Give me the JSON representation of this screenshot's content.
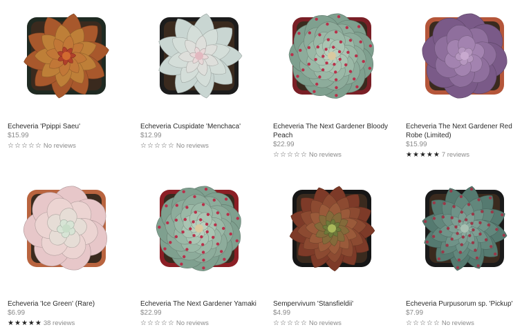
{
  "products": [
    {
      "title": "Echeveria 'Ppippi Saeu'",
      "price": "$15.99",
      "reviews": "No reviews",
      "stars_filled": 0,
      "plant": "rust-star",
      "pot_color": "#1f2a22"
    },
    {
      "title": "Echeveria Cuspidate 'Menchaca'",
      "price": "$12.99",
      "reviews": "No reviews",
      "stars_filled": 0,
      "plant": "pale-spiky",
      "pot_color": "#1c1c1c"
    },
    {
      "title": "Echeveria The Next Gardener Bloody Peach",
      "price": "$22.99",
      "reviews": "No reviews",
      "stars_filled": 0,
      "plant": "green-red-tipped",
      "pot_color": "#7a1f26"
    },
    {
      "title": "Echeveria The Next Gardener Red Robe (Limited)",
      "price": "$15.99",
      "reviews": "7 reviews",
      "stars_filled": 5,
      "plant": "purple-rose",
      "pot_color": "#b5563a"
    },
    {
      "title": "Echeveria 'Ice Green' (Rare)",
      "price": "$6.99",
      "reviews": "38 reviews",
      "stars_filled": 5,
      "plant": "pink-white",
      "pot_color": "#b9643f"
    },
    {
      "title": "Echeveria The Next Gardener Yamaki",
      "price": "$22.99",
      "reviews": "No reviews",
      "stars_filled": 0,
      "plant": "green-red-tipped",
      "pot_color": "#8c1f25"
    },
    {
      "title": "Sempervivum 'Stansfieldii'",
      "price": "$4.99",
      "reviews": "No reviews",
      "stars_filled": 0,
      "plant": "dark-red-semp",
      "pot_color": "#161616"
    },
    {
      "title": "Echeveria Purpusorum sp. 'Pickup'",
      "price": "$7.99",
      "reviews": "No reviews",
      "stars_filled": 0,
      "plant": "spotted-green",
      "pot_color": "#1a1a1a"
    }
  ]
}
